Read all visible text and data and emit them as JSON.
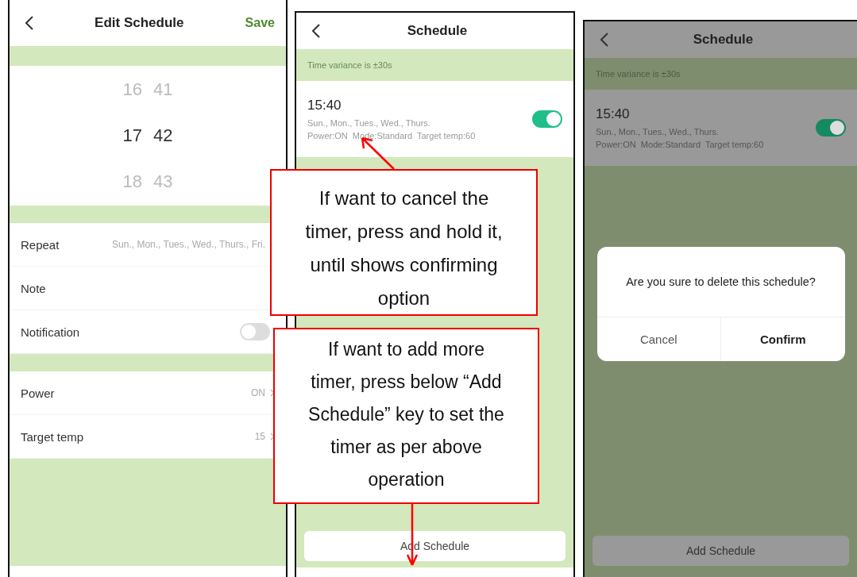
{
  "edit_schedule": {
    "title": "Edit Schedule",
    "save": "Save",
    "time_picker": [
      {
        "hour": "16",
        "minute": "41",
        "selected": false
      },
      {
        "hour": "17",
        "minute": "42",
        "selected": true
      },
      {
        "hour": "18",
        "minute": "43",
        "selected": false
      }
    ],
    "groups": [
      [
        {
          "kind": "value",
          "label": "Repeat",
          "value": "Sun., Mon., Tues., Wed., Thurs., Fri."
        },
        {
          "kind": "value",
          "label": "Note"
        },
        {
          "kind": "toggle",
          "label": "Notification",
          "on": false
        }
      ],
      [
        {
          "kind": "value",
          "label": "Power",
          "value": "ON"
        },
        {
          "kind": "value",
          "label": "Target temp",
          "value": "15"
        }
      ]
    ]
  },
  "schedule": {
    "title": "Schedule",
    "note": "Time variance is ±30s",
    "items": [
      {
        "time": "15:40",
        "days": "Sun., Mon., Tues., Wed., Thurs.",
        "details": "Power:ON  Mode:Standard  Target temp:60",
        "on": true
      }
    ],
    "add_button": "Add Schedule"
  },
  "delete_confirm": {
    "title": "Schedule",
    "note": "Time variance is ±30s",
    "items": [
      {
        "time": "15:40",
        "days": "Sun., Mon., Tues., Wed., Thurs.",
        "details": "Power:ON  Mode:Standard  Target temp:60",
        "on": true
      }
    ],
    "dialog": {
      "message": "Are you sure to delete this schedule?",
      "buttons": [
        {
          "kind": "cancel",
          "label": "Cancel"
        },
        {
          "kind": "confirm",
          "label": "Confirm"
        }
      ]
    },
    "add_button": "Add Schedule"
  },
  "callouts": [
    "If want to cancel the timer, press and hold it, until shows confirming option",
    "If want to add more timer, press below “Add Schedule” key to set the timer as per above operation"
  ]
}
